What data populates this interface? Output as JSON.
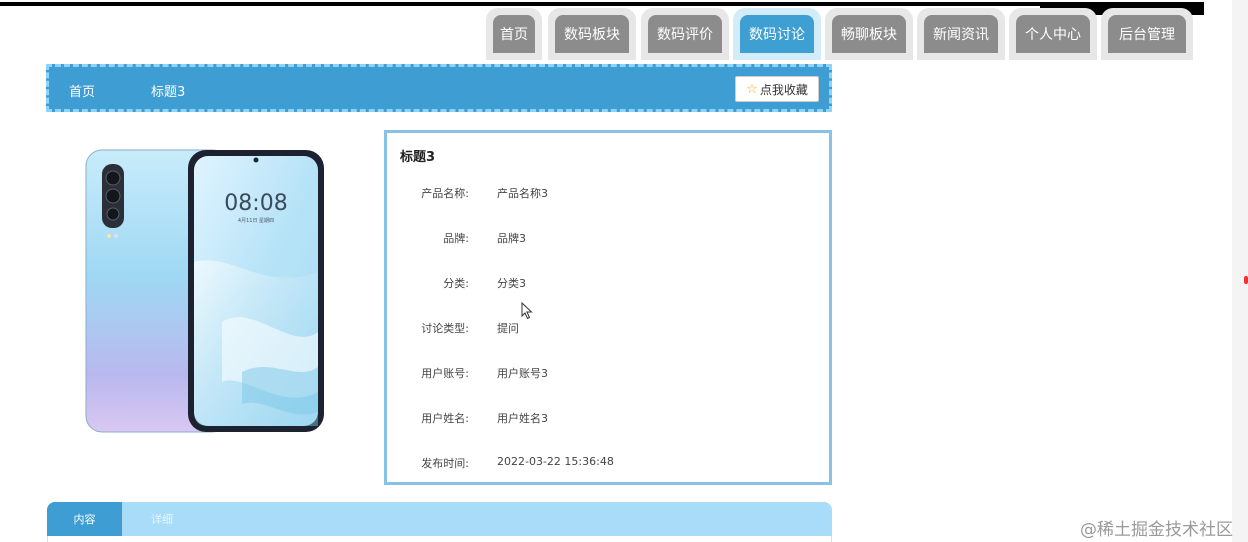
{
  "nav": {
    "tabs": [
      {
        "label": "首页",
        "active": false
      },
      {
        "label": "数码板块",
        "active": false
      },
      {
        "label": "数码评价",
        "active": false
      },
      {
        "label": "数码讨论",
        "active": true
      },
      {
        "label": "畅聊板块",
        "active": false
      },
      {
        "label": "新闻资讯",
        "active": false
      },
      {
        "label": "个人中心",
        "active": false
      },
      {
        "label": "后台管理",
        "active": false
      }
    ]
  },
  "breadcrumb": {
    "home": "首页",
    "current": "标题3",
    "favorite_label": "点我收藏",
    "favorite_icon": "☆"
  },
  "phone": {
    "time": "08:08",
    "date": "4月11日 星期四"
  },
  "detail": {
    "title": "标题3",
    "rows": [
      {
        "label": "产品名称:",
        "value": "产品名称3"
      },
      {
        "label": "品牌:",
        "value": "品牌3"
      },
      {
        "label": "分类:",
        "value": "分类3"
      },
      {
        "label": "讨论类型:",
        "value": "提问"
      },
      {
        "label": "用户账号:",
        "value": "用户账号3"
      },
      {
        "label": "用户姓名:",
        "value": "用户姓名3"
      },
      {
        "label": "发布时间:",
        "value": "2022-03-22 15:36:48"
      }
    ]
  },
  "tabs_bottom": {
    "content": "内容",
    "details": "详细"
  },
  "watermark": "@稀土掘金技术社区",
  "colors": {
    "accent": "#3e9dd3",
    "nav_inactive": "#8c8c8c",
    "panel_border": "#88c3e6"
  }
}
